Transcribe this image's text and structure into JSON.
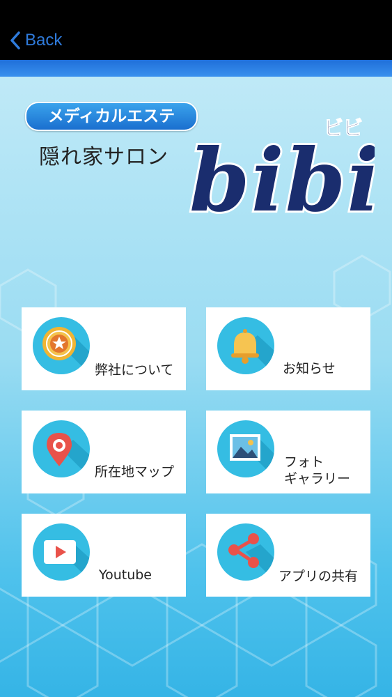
{
  "nav": {
    "back_label": "Back"
  },
  "logo": {
    "pill_text": "メディカルエステ",
    "subtitle": "隠れ家サロン",
    "brand": "bibi",
    "brand_kana": "ビビ"
  },
  "menu": [
    {
      "label": "弊社について",
      "icon": "star-medal-icon"
    },
    {
      "label": "お知らせ",
      "icon": "bell-icon"
    },
    {
      "label": "所在地マップ",
      "icon": "map-pin-icon"
    },
    {
      "label": "フォト\nギャラリー",
      "icon": "photo-gallery-icon"
    },
    {
      "label": "Youtube",
      "icon": "youtube-play-icon"
    },
    {
      "label": "アプリの共有",
      "icon": "share-icon"
    }
  ],
  "colors": {
    "accent": "#2f7bdc",
    "icon_bg": "#35bde3",
    "bar": "#1f6fd9",
    "brand": "#1a2d6e"
  }
}
